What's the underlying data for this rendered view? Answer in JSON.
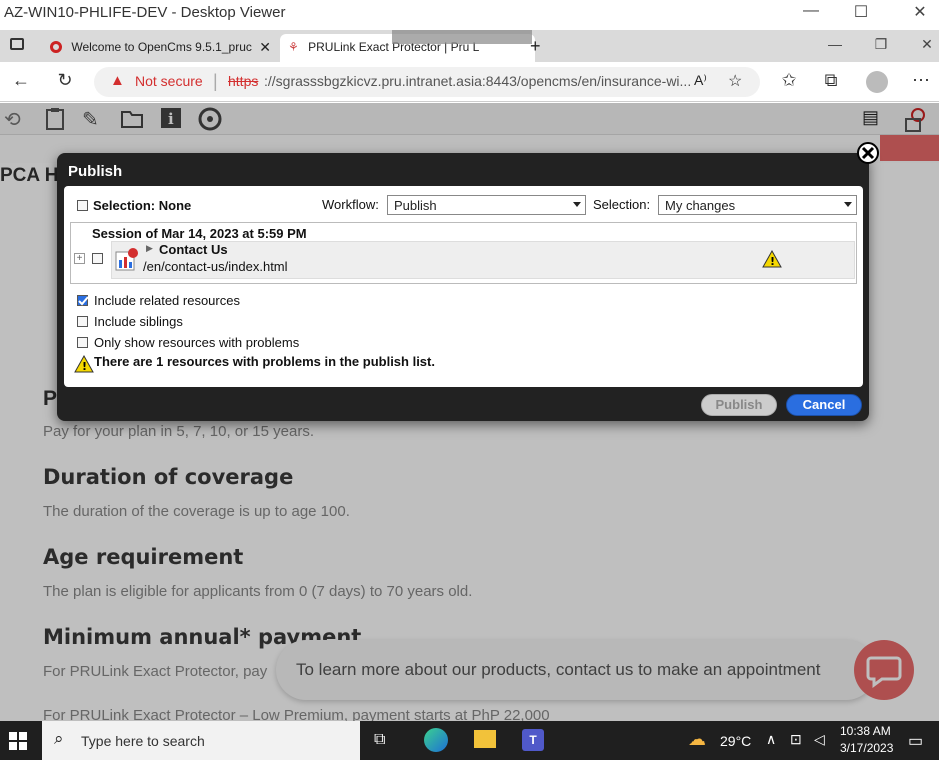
{
  "viewer": {
    "title": "AZ-WIN10-PHLIFE-DEV - Desktop Viewer"
  },
  "browser": {
    "tabs": [
      {
        "label": "Welcome to OpenCms 9.5.1_pruc",
        "active": false
      },
      {
        "label": "PRULink Exact Protector | Pru L",
        "active": true
      }
    ],
    "security_label": "Not secure",
    "url_scheme": "https",
    "url_rest": "://sgrasssbgzkicvz.pru.intranet.asia:8443/opencms/en/insurance-wi..."
  },
  "page": {
    "partial_heading_top": "PCA He",
    "partial_heading_left": "P",
    "pay_text": "Pay for your plan in 5, 7, 10, or 15 years.",
    "sections": [
      {
        "heading": "Duration of coverage",
        "text": "The duration of the coverage is up to age 100."
      },
      {
        "heading": "Age requirement",
        "text": "The plan is eligible for applicants from 0 (7 days) to 70 years old."
      },
      {
        "heading": "Minimum annual* payment",
        "text": "For PRULink Exact Protector, pay"
      }
    ],
    "bottom_text": "For PRULink Exact Protector – Low Premium, payment starts at PhP 22,000",
    "chat_text": "To learn more about our products, contact us to make an appointment"
  },
  "dialog": {
    "title": "Publish",
    "selection_label": "Selection: None",
    "workflow_label": "Workflow:",
    "workflow_value": "Publish",
    "selection_select_label": "Selection:",
    "selection_value": "My changes",
    "session_label": "Session of Mar 14, 2023 at 5:59 PM",
    "resource_title": "Contact Us",
    "resource_path": "/en/contact-us/index.html",
    "options": [
      {
        "label": "Include related resources",
        "checked": true
      },
      {
        "label": "Include siblings",
        "checked": false
      },
      {
        "label": "Only show resources with problems",
        "checked": false
      }
    ],
    "problem_message": "There are 1 resources with problems in the publish list.",
    "publish_label": "Publish",
    "cancel_label": "Cancel"
  },
  "taskbar": {
    "search_placeholder": "Type here to search",
    "temperature": "29°C",
    "time": "10:38 AM",
    "date": "3/17/2023"
  },
  "colors": {
    "accent": "#2a6ee0",
    "danger": "#d32f2f",
    "brand": "#e96a6a"
  }
}
